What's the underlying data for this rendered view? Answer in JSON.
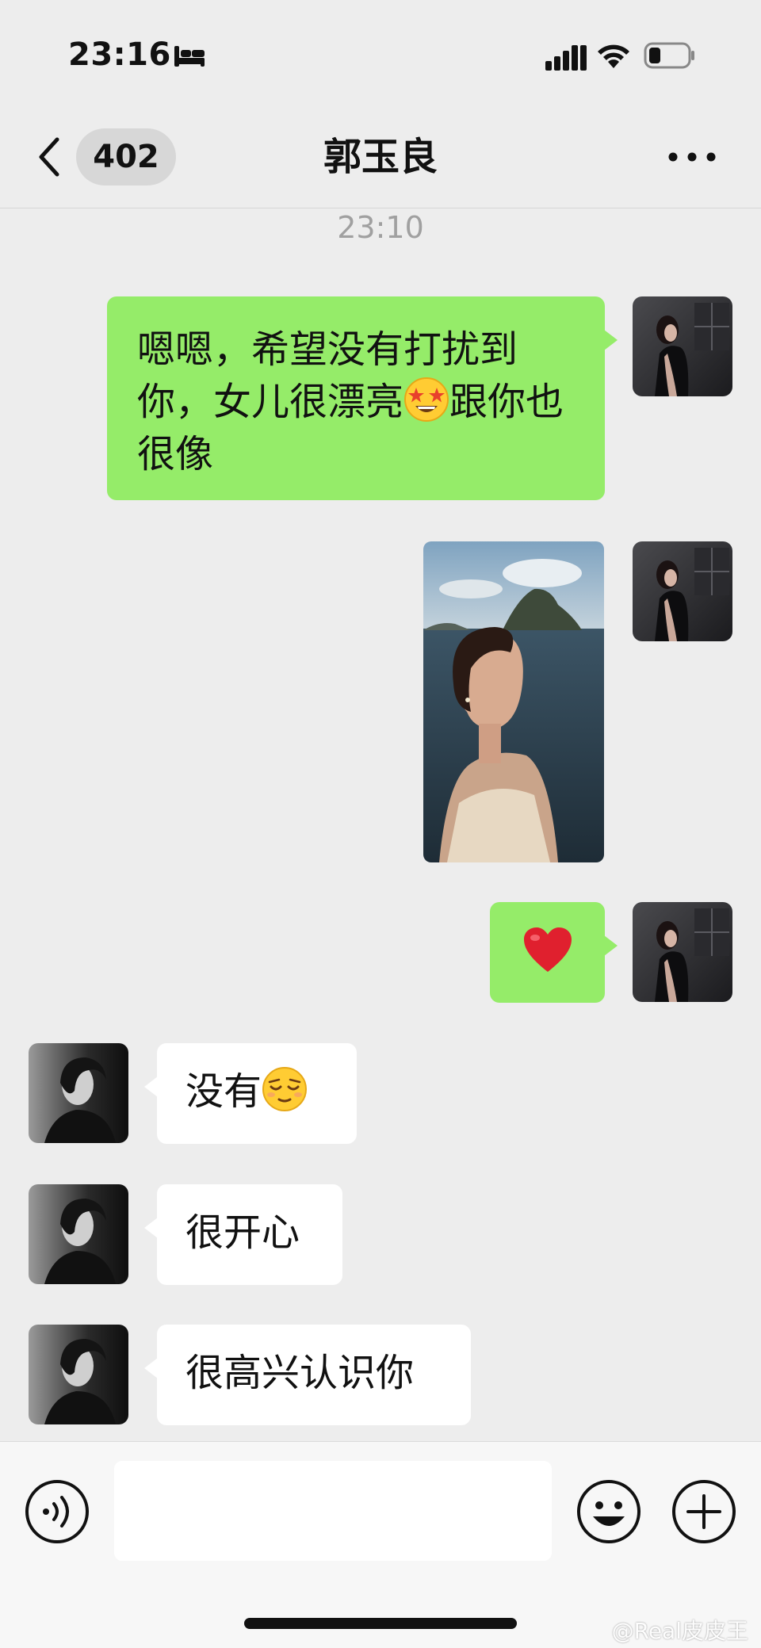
{
  "status_bar": {
    "time": "23:16",
    "icons": [
      "bed-icon",
      "cellular-signal-icon",
      "wifi-icon",
      "battery-icon"
    ]
  },
  "nav": {
    "back_icon": "chevron-left-icon",
    "unread_count": "402",
    "title": "郭玉良",
    "more_icon": "ellipsis-icon"
  },
  "chat": {
    "timestamp": "23:10",
    "messages": [
      {
        "sender": "me",
        "type": "text",
        "text": "嗯嗯，希望没有打扰到你，女儿很漂亮",
        "emoji": "🤩",
        "text_after": "跟你也很像"
      },
      {
        "sender": "me",
        "type": "image",
        "content": "photo of a woman by the sea with karst islands"
      },
      {
        "sender": "me",
        "type": "emoji",
        "emoji": "❤️"
      },
      {
        "sender": "other",
        "type": "text",
        "text": "没有",
        "emoji": "😌"
      },
      {
        "sender": "other",
        "type": "text",
        "text": "很开心"
      },
      {
        "sender": "other",
        "type": "text",
        "text": "很高兴认识你"
      }
    ]
  },
  "input_bar": {
    "voice_icon": "voice-input-icon",
    "input_value": "",
    "emoji_icon": "emoji-face-icon",
    "plus_icon": "add-plus-icon"
  },
  "watermark": "@Real皮皮王",
  "colors": {
    "background": "#ededed",
    "my_bubble": "#95ec69",
    "their_bubble": "#ffffff",
    "timestamp": "#a0a0a0"
  }
}
